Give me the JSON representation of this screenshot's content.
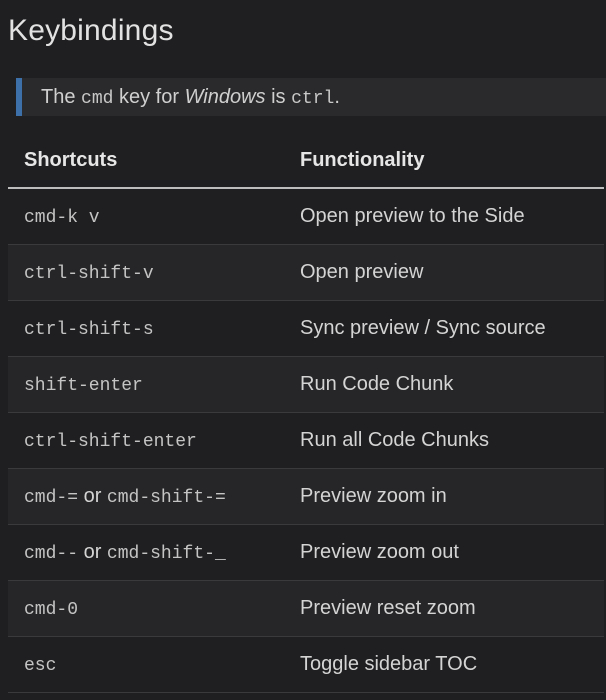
{
  "heading": "Keybindings",
  "note": {
    "part1": "The ",
    "code1": "cmd",
    "part2": " key for ",
    "emph": "Windows",
    "part3": " is ",
    "code2": "ctrl",
    "part4": "."
  },
  "table": {
    "headers": [
      "Shortcuts",
      "Functionality"
    ],
    "rows": [
      {
        "key": "cmd-k v",
        "alt_sep": "",
        "alt_key": "",
        "desc": "Open preview to the Side"
      },
      {
        "key": "ctrl-shift-v",
        "alt_sep": "",
        "alt_key": "",
        "desc": "Open preview"
      },
      {
        "key": "ctrl-shift-s",
        "alt_sep": "",
        "alt_key": "",
        "desc": "Sync preview / Sync source"
      },
      {
        "key": "shift-enter",
        "alt_sep": "",
        "alt_key": "",
        "desc": "Run Code Chunk"
      },
      {
        "key": "ctrl-shift-enter",
        "alt_sep": "",
        "alt_key": "",
        "desc": "Run all Code Chunks"
      },
      {
        "key": "cmd-=",
        "alt_sep": " or ",
        "alt_key": "cmd-shift-=",
        "desc": "Preview zoom in"
      },
      {
        "key": "cmd--",
        "alt_sep": " or ",
        "alt_key": "cmd-shift-_",
        "desc": "Preview zoom out"
      },
      {
        "key": "cmd-0",
        "alt_sep": "",
        "alt_key": "",
        "desc": "Preview reset zoom"
      },
      {
        "key": "esc",
        "alt_sep": "",
        "alt_key": "",
        "desc": "Toggle sidebar TOC"
      }
    ]
  }
}
